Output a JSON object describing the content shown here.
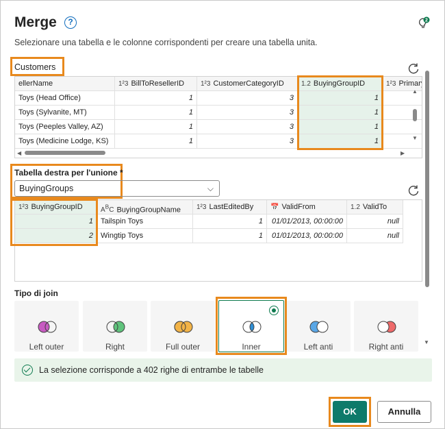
{
  "dialog": {
    "title": "Merge",
    "subtitle": "Selezionare una tabella e le colonne corrispondenti per creare una tabella unita."
  },
  "left_table": {
    "name": "Customers",
    "columns": [
      {
        "type": "",
        "label": "ellerName"
      },
      {
        "type": "1²3",
        "label": "BillToResellerID"
      },
      {
        "type": "1²3",
        "label": "CustomerCategoryID"
      },
      {
        "type": "1.2",
        "label": "BuyingGroupID"
      },
      {
        "type": "1²3",
        "label": "Primary"
      }
    ],
    "rows": [
      [
        "Toys (Head Office)",
        "1",
        "3",
        "1",
        ""
      ],
      [
        "Toys (Sylvanite, MT)",
        "1",
        "3",
        "1",
        ""
      ],
      [
        "Toys (Peeples Valley, AZ)",
        "1",
        "3",
        "1",
        ""
      ],
      [
        "Toys (Medicine Lodge, KS)",
        "1",
        "3",
        "1",
        ""
      ]
    ]
  },
  "right_table": {
    "label": "Tabella destra per l'unione *",
    "selected": "BuyingGroups",
    "columns": [
      {
        "type": "1²3",
        "label": "BuyingGroupID"
      },
      {
        "type": "ABC",
        "label": "BuyingGroupName"
      },
      {
        "type": "1²3",
        "label": "LastEditedBy"
      },
      {
        "type": "cal",
        "label": "ValidFrom"
      },
      {
        "type": "1.2",
        "label": "ValidTo"
      }
    ],
    "rows": [
      [
        "1",
        "Tailspin Toys",
        "1",
        "01/01/2013, 00:00:00",
        "null"
      ],
      [
        "2",
        "Wingtip Toys",
        "1",
        "01/01/2013, 00:00:00",
        "null"
      ]
    ]
  },
  "join": {
    "label": "Tipo di join",
    "types": [
      {
        "label": "Left outer",
        "left": "#c75bc1",
        "right": "#ffffff",
        "overlap": "#c75bc1"
      },
      {
        "label": "Right",
        "left": "#ffffff",
        "right": "#5fc37c",
        "overlap": "#5fc37c"
      },
      {
        "label": "Full outer",
        "left": "#f2b347",
        "right": "#f2b347",
        "overlap": "#f2b347"
      },
      {
        "label": "Inner",
        "left": "#ffffff",
        "right": "#ffffff",
        "overlap": "#2f8fd6"
      },
      {
        "label": "Left anti",
        "left": "#5aa7e6",
        "right": "#ffffff",
        "overlap": "#ffffff"
      },
      {
        "label": "Right anti",
        "left": "#ffffff",
        "right": "#ee6a6a",
        "overlap": "#ffffff"
      }
    ],
    "selected": "Inner"
  },
  "status": {
    "text": "La selezione corrisponde a 402 righe di entrambe le tabelle"
  },
  "buttons": {
    "ok": "OK",
    "cancel": "Annulla"
  },
  "colors": {
    "highlight": "#e8891d",
    "accent": "#0e7a6a",
    "selected_column": "#e6f2ea"
  }
}
